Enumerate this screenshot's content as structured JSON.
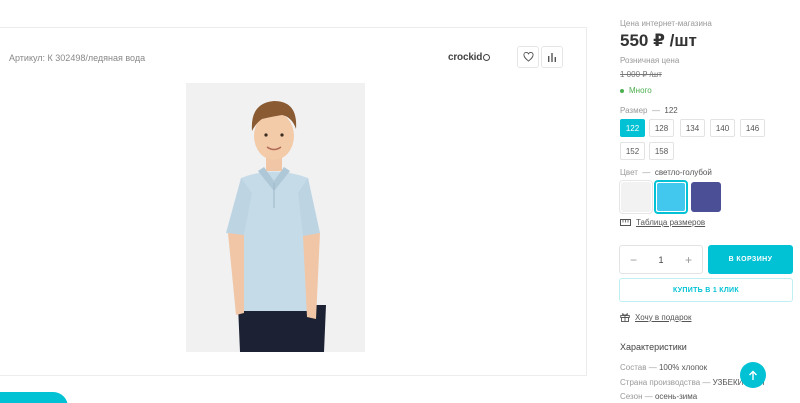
{
  "product": {
    "sku_text": "Артикул: К 302498/ледяная вода",
    "brand": "crockid",
    "favorite_icon": "heart-icon",
    "compare_icon": "bar-chart-icon"
  },
  "pricing": {
    "online_label": "Цена интернет-магазина",
    "online_price": "550 ₽ /шт",
    "retail_label": "Розничная цена",
    "retail_price": "1 000 ₽ /шт",
    "stock": "Много"
  },
  "size": {
    "label": "Размер",
    "dash": "—",
    "selected": "122",
    "options": [
      "122",
      "128",
      "134",
      "140",
      "146",
      "152",
      "158"
    ]
  },
  "color": {
    "label": "Цвет",
    "dash": "—",
    "selected": "светло-голубой",
    "swatches": [
      "#f2f2f2",
      "#42c8ee",
      "#4a4f96"
    ]
  },
  "size_table_link": "Таблица размеров",
  "purchase": {
    "quantity": "1",
    "minus": "−",
    "plus": "+",
    "add_to_cart": "В КОРЗИНУ",
    "one_click": "КУПИТЬ В 1 КЛИК",
    "gift_link": "Хочу в подарок"
  },
  "characteristics": {
    "title": "Характеристики",
    "rows": [
      {
        "name": "Состав",
        "value": "100% хлопок"
      },
      {
        "name": "Страна производства",
        "value": "УЗБЕКИСТАН"
      },
      {
        "name": "Сезон",
        "value": "осень-зима"
      }
    ]
  },
  "colors": {
    "accent": "#00c2d4",
    "in_stock": "#4caf50"
  }
}
